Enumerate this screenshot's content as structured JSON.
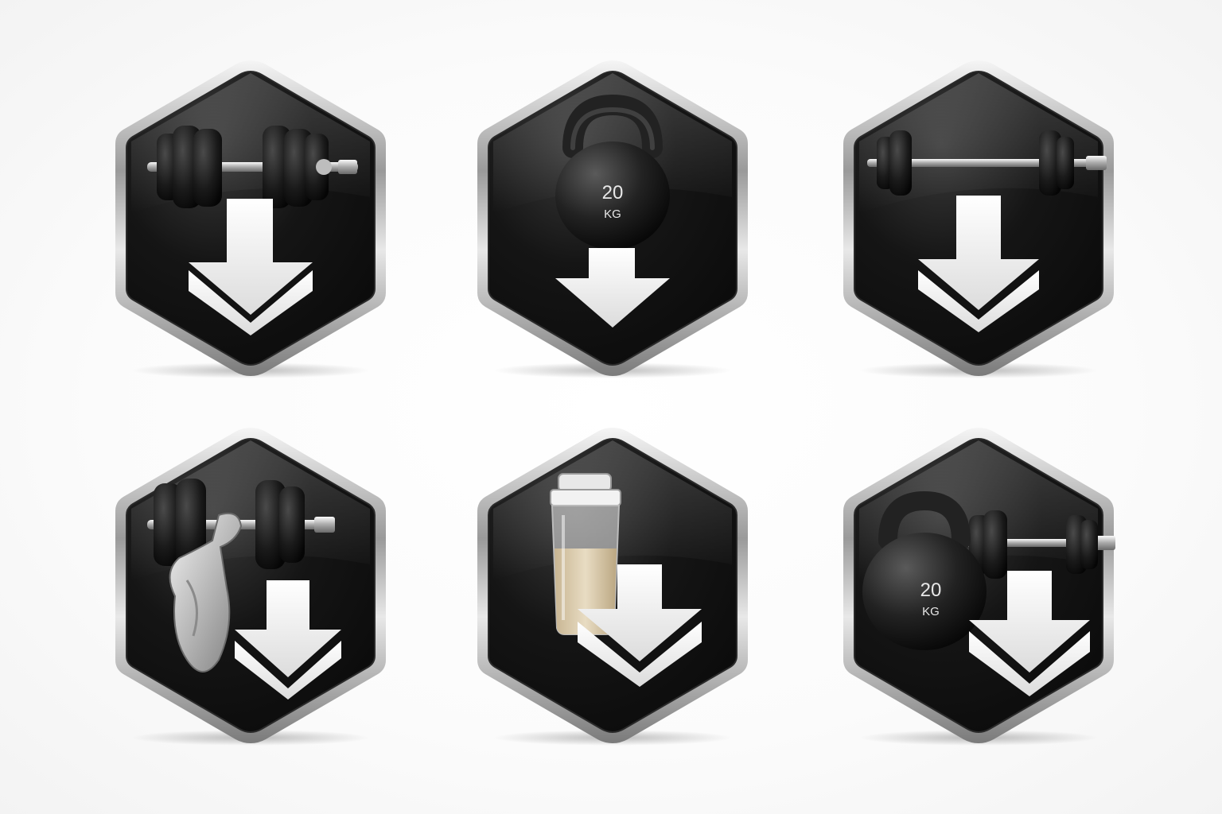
{
  "icons": [
    {
      "id": "dumbbell-download",
      "name": "dumbbell-download-icon"
    },
    {
      "id": "kettlebell-download",
      "name": "kettlebell-download-icon",
      "weight": "20",
      "unit": "KG"
    },
    {
      "id": "barbell-download",
      "name": "barbell-download-icon"
    },
    {
      "id": "arm-dumbbell-download",
      "name": "flexed-arm-dumbbell-download-icon"
    },
    {
      "id": "shaker-download",
      "name": "protein-shaker-download-icon"
    },
    {
      "id": "kettlebell-barbell-download",
      "name": "kettlebell-barbell-download-icon",
      "weight": "20",
      "unit": "KG"
    }
  ],
  "colors": {
    "badge_fill": "#141414",
    "badge_rim": "#c9c9c9",
    "arrow": "#f4f4f4",
    "plate": "#1c1c1c",
    "chrome": "#cfcfcf",
    "shake": "#d9c7a6"
  }
}
